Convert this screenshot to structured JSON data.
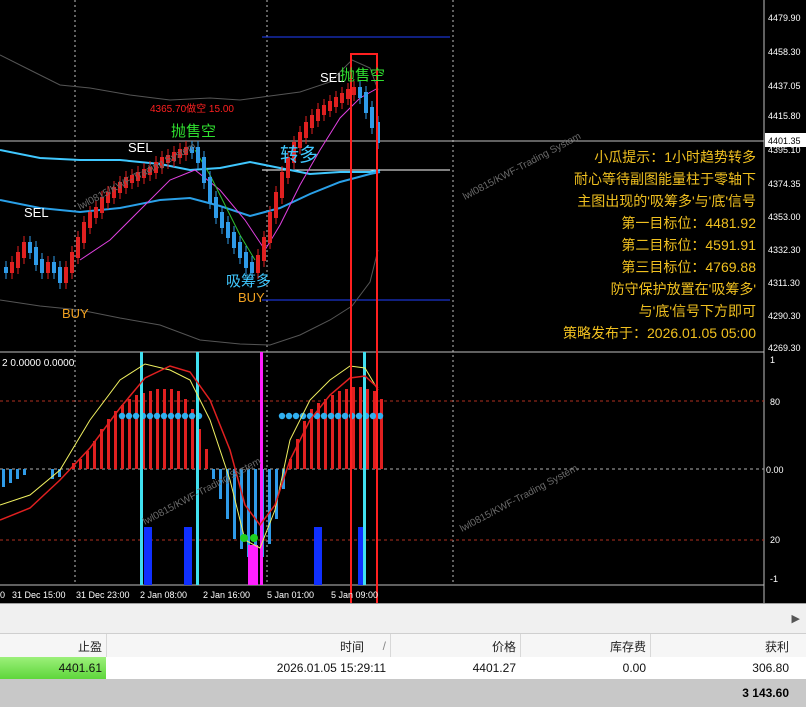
{
  "prices": [
    "4479.90",
    "4458.30",
    "4437.05",
    "4415.80",
    "4401.35",
    "4395.10",
    "4374.35",
    "4353.00",
    "4332.30",
    "4311.30",
    "4290.30",
    "4269.30"
  ],
  "price_marker": "4401.35",
  "times": [
    "0",
    "31 Dec 15:00",
    "31 Dec 23:00",
    "2 Jan 08:00",
    "2 Jan 16:00",
    "5 Jan 01:00",
    "5 Jan 09:00"
  ],
  "sub_header": "2 0.0000 0.0000",
  "sub_levels": [
    "1",
    "80",
    "0.00",
    "20",
    "-1"
  ],
  "signals": {
    "sel1": "SEL",
    "sel2": "SEL",
    "sel3": "SEL",
    "buy1": "BUY",
    "buy2": "BUY",
    "sell_short1": "抛售空",
    "sell_short2": "抛售空",
    "turn_long": "转多",
    "absorb": "吸筹多",
    "short_price": "4365.70做空 15.00"
  },
  "watermark": "lwl0815/KWF-Trading System",
  "strategy": {
    "lines": [
      "小瓜提示：1小时趋势转多",
      "耐心等待副图能量柱于零轴下",
      "主图出现的'吸筹多'与'底'信号",
      "第一目标位：4481.92",
      "第二目标位：4591.91",
      "第三目标位：4769.88",
      "防守保护放置在'吸筹多'",
      "与'底'信号下方即可",
      "策略发布于：2026.01.05 05:00"
    ]
  },
  "table": {
    "headers": {
      "tp": "止盈",
      "time": "时间",
      "sort": "/",
      "price": "价格",
      "swap": "库存费",
      "profit": "获利"
    },
    "row": {
      "tp": "4401.61",
      "time": "2026.01.05 15:29:11",
      "price": "4401.27",
      "swap": "0.00",
      "profit": "306.80"
    },
    "total": "3 143.60"
  },
  "colors": {
    "bull": "#e02020",
    "bear": "#2f9be8",
    "ma": "#00bfff",
    "band": "#555555",
    "accent": "#f0c020",
    "magenta": "#ff20ff",
    "cyan": "#40e0f0",
    "highlight": "#ff2020"
  }
}
